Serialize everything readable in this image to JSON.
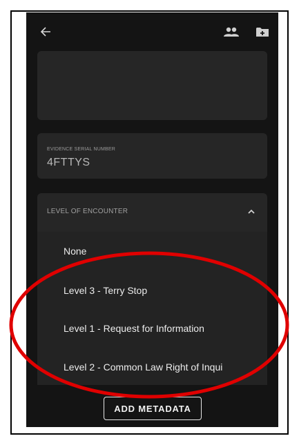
{
  "header": {
    "back_icon": "arrow-left-icon",
    "people_icon": "people-icon",
    "folder_icon": "folder-plus-icon"
  },
  "serial": {
    "label": "EVIDENCE SERIAL NUMBER",
    "value": "4FTTYS"
  },
  "level": {
    "label": "LEVEL OF ENCOUNTER",
    "options": [
      "None",
      "Level 3 - Terry Stop",
      "Level 1 - Request for Information",
      "Level 2 - Common Law Right of Inqui"
    ]
  },
  "actions": {
    "add_metadata": "ADD METADATA"
  },
  "colors": {
    "background": "#141414",
    "card": "#262626",
    "annotation": "#e00000"
  }
}
